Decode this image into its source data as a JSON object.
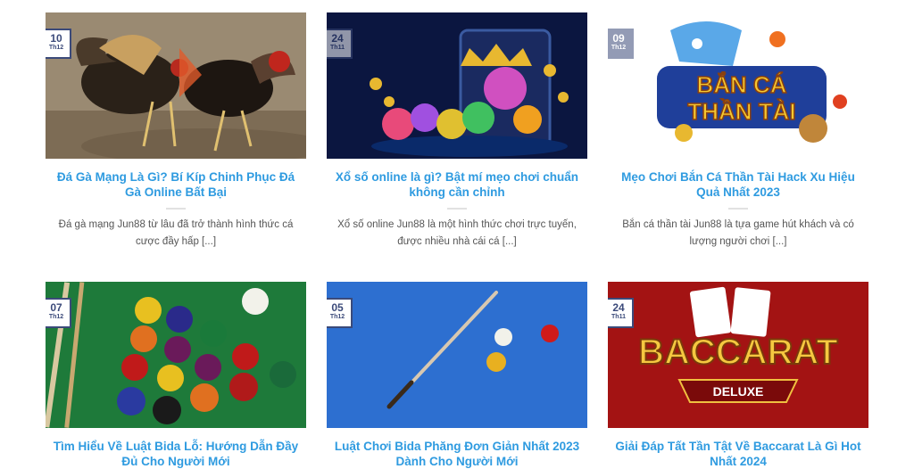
{
  "posts": [
    {
      "day": "10",
      "month": "Th12",
      "title": "Đá Gà Mạng Là Gì? Bí Kíp Chinh Phục Đá Gà Online Bất Bại",
      "excerpt": "Đá gà mạng Jun88 từ lâu đã trở thành hình thức cá cược đầy hấp [...]",
      "image": "rooster-fight-photo"
    },
    {
      "day": "24",
      "month": "Th11",
      "title": "Xổ số online là gì? Bật mí mẹo chơi chuẩn không cần chỉnh",
      "excerpt": "Xổ số online Jun88 là một hình thức chơi trực tuyến, được nhiều nhà cái cá [...]",
      "image": "lottery-balls-phone"
    },
    {
      "day": "09",
      "month": "Th12",
      "title": "Mẹo Chơi Bắn Cá Thần Tài Hack Xu Hiệu Quả Nhất 2023",
      "excerpt": "Bắn cá thần tài Jun88 là tựa game hút khách và có lượng người chơi [...]",
      "image": "ban-ca-than-tai-logo",
      "logo_text_1": "BẮN CÁ",
      "logo_text_2": "THẦN TÀI"
    },
    {
      "day": "07",
      "month": "Th12",
      "title": "Tìm Hiểu Về Luật Bida Lỗ: Hướng Dẫn Đầy Đủ Cho Người Mới",
      "excerpt": "",
      "image": "billiard-balls-rack"
    },
    {
      "day": "05",
      "month": "Th12",
      "title": "Luật Chơi Bida Phăng Đơn Giản Nhất 2023 Dành Cho Người Mới",
      "excerpt": "",
      "image": "billiard-cue-table"
    },
    {
      "day": "24",
      "month": "Th11",
      "title": "Giải Đáp Tất Tần Tật Về Baccarat Là Gì Hot Nhất 2024",
      "excerpt": "",
      "image": "baccarat-deluxe-logo",
      "logo_text_1": "BACCARAT",
      "logo_text_2": "DELUXE"
    }
  ],
  "colors": {
    "title": "#2f9be0",
    "excerpt": "#555555",
    "badge": "#3b4a7a",
    "divider": "#e1e1e1"
  }
}
